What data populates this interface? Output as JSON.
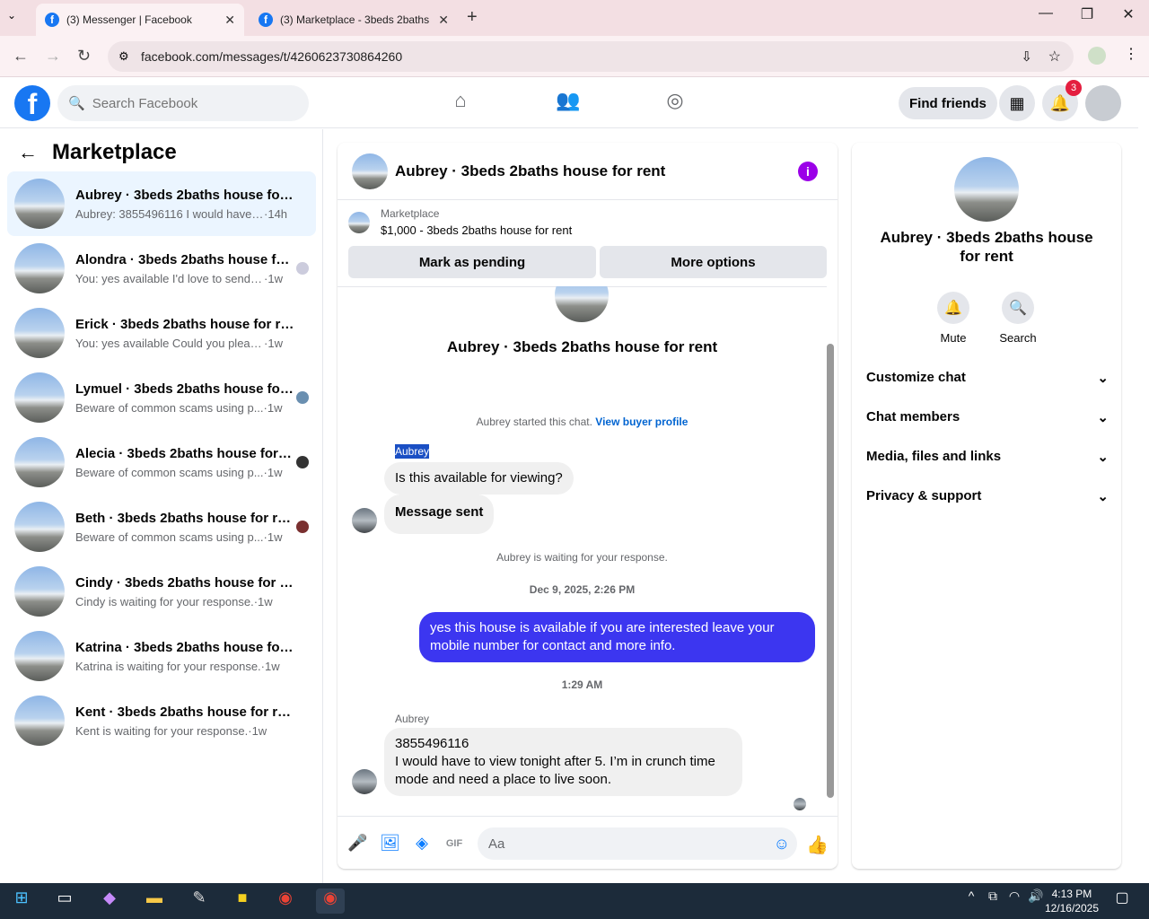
{
  "browser": {
    "tabs": [
      {
        "title": "(3) Messenger | Facebook"
      },
      {
        "title": "(3) Marketplace - 3beds 2baths"
      }
    ],
    "url": "facebook.com/messages/t/4260623730864260"
  },
  "header": {
    "search_placeholder": "Search Facebook",
    "find_friends": "Find friends",
    "notif_count": "3"
  },
  "left": {
    "title": "Marketplace",
    "conversations": [
      {
        "name": "Aubrey · 3beds 2baths house for rent",
        "preview": "Aubrey: 3855496116 I would have to...",
        "time": "14h"
      },
      {
        "name": "Alondra · 3beds 2baths house for rent",
        "preview": "You: yes available I'd love to send y...",
        "time": "1w"
      },
      {
        "name": "Erick · 3beds 2baths house for rent",
        "preview": "You: yes available Could you please s...",
        "time": "1w"
      },
      {
        "name": "Lymuel · 3beds 2baths house for rent",
        "preview": "Beware of common scams using p...",
        "time": "1w"
      },
      {
        "name": "Alecia · 3beds 2baths house for rent",
        "preview": "Beware of common scams using p...",
        "time": "1w"
      },
      {
        "name": "Beth · 3beds 2baths house for rent",
        "preview": "Beware of common scams using p...",
        "time": "1w"
      },
      {
        "name": "Cindy · 3beds 2baths house for rent",
        "preview": "Cindy is waiting for your response.",
        "time": "1w"
      },
      {
        "name": "Katrina · 3beds 2baths house for rent",
        "preview": "Katrina is waiting for your response.",
        "time": "1w"
      },
      {
        "name": "Kent · 3beds 2baths house for rent",
        "preview": "Kent is waiting for your response.",
        "time": "1w"
      }
    ]
  },
  "chat": {
    "title": "Aubrey · 3beds 2baths house for rent",
    "marketplace_label": "Marketplace",
    "listing": "$1,000 - 3beds 2baths house for rent",
    "mark_pending": "Mark as pending",
    "more_options": "More options",
    "intro_title": "Aubrey · 3beds 2baths house for rent",
    "started": "Aubrey started this chat.",
    "view_profile": "View buyer profile",
    "sender": "Aubrey",
    "msg1": "Is this available for viewing?",
    "msg2": "Message sent",
    "waiting": "Aubrey is waiting for your response.",
    "date1": "Dec 9, 2025, 2:26 PM",
    "my_msg": "yes this house is available if  you are  interested leave your mobile number for contact and more info.",
    "time2": "1:29 AM",
    "sender2": "Aubrey",
    "msg3_line1": "3855496116",
    "msg3_line2": "I would have to view tonight after 5. I’m in crunch time mode and need a place to live soon.",
    "composer_placeholder": "Aa"
  },
  "right": {
    "name": "Aubrey · 3beds 2baths house for rent",
    "mute": "Mute",
    "search": "Search",
    "sections": [
      "Customize chat",
      "Chat members",
      "Media, files and links",
      "Privacy & support"
    ]
  },
  "taskbar": {
    "time": "4:13 PM",
    "date": "12/16/2025"
  }
}
